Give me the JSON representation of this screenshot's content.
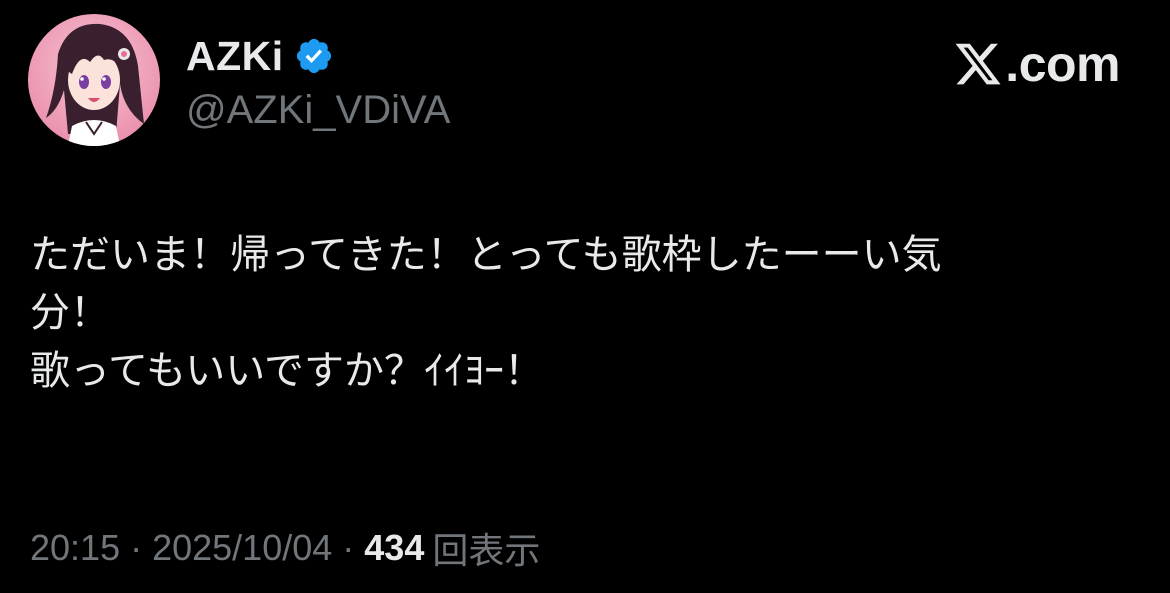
{
  "author": {
    "display_name": "AZKi",
    "handle": "@AZKi_VDiVA",
    "verified_icon": "verified-badge-icon",
    "avatar_icon": "avatar"
  },
  "brand": {
    "logo_icon": "x-logo-icon",
    "label": ".com"
  },
  "tweet": {
    "lines": [
      "ただいま！帰ってきた！とっても歌枠したーーい気",
      "分！",
      "歌ってもいいですか？ｲｲﾖｰ！"
    ]
  },
  "meta": {
    "time": "20:15",
    "separator": "·",
    "date": "2025/10/04",
    "views_count": "434",
    "views_label": "回表示"
  },
  "colors": {
    "background": "#000000",
    "primary_text": "#e7e9ea",
    "secondary_text": "#71767b",
    "verified": "#1d9bf0"
  }
}
